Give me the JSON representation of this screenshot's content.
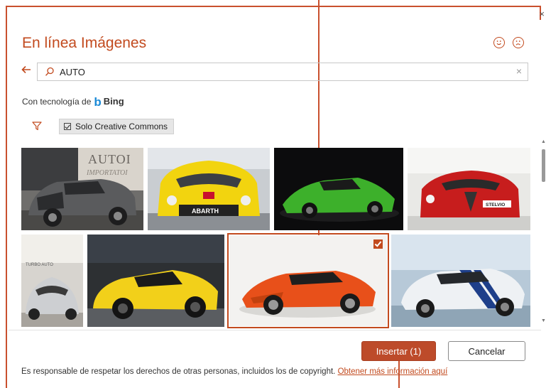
{
  "dialog": {
    "title": "En línea Imágenes",
    "close_glyph": "×",
    "feedback_icons": [
      "smile-icon",
      "frown-icon"
    ]
  },
  "search": {
    "value": "AUTO",
    "back_icon": "back-arrow-icon",
    "search_icon": "search-icon",
    "clear_glyph": "×"
  },
  "powered": {
    "prefix": "Con tecnología de",
    "brand_mark": "b",
    "brand": "Bing"
  },
  "filters": {
    "filter_icon": "filter-icon",
    "creative_commons_label": "Solo Creative Commons",
    "creative_commons_checked": true
  },
  "images": [
    {
      "id": 1,
      "subject": "grey SUV at auto show",
      "selected": false,
      "sign_text": "AUTOI\nIMPORTATOI"
    },
    {
      "id": 2,
      "subject": "yellow Abarth front",
      "selected": false,
      "plate_text": "ABARTH"
    },
    {
      "id": 3,
      "subject": "green Lamborghini Huracan",
      "selected": false
    },
    {
      "id": 4,
      "subject": "red Alfa Romeo Stelvio",
      "selected": false,
      "plate_text": "STELVIO"
    },
    {
      "id": 5,
      "subject": "silver convertible",
      "selected": false,
      "sign_text": "TURBO AUTO"
    },
    {
      "id": 6,
      "subject": "yellow Lamborghini Urus",
      "selected": false
    },
    {
      "id": 7,
      "subject": "orange Lamborghini Aventador",
      "selected": true
    },
    {
      "id": 8,
      "subject": "white Shelby Mustang with blue stripes",
      "selected": false
    }
  ],
  "footer": {
    "insert_label": "Insertar (1)",
    "cancel_label": "Cancelar",
    "notice": "Es responsable de respetar los derechos de otras personas, incluidos los de copyright.",
    "link": "Obtener más información aquí"
  },
  "colors": {
    "accent": "#c24a1e",
    "primary_button": "#bd4b2a",
    "bing_blue": "#1a8ad7"
  }
}
